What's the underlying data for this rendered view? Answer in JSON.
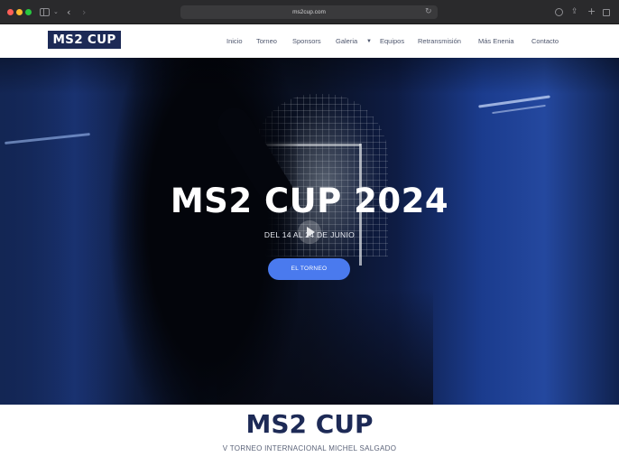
{
  "browser": {
    "url": "ms2cup.com"
  },
  "header": {
    "logo_text": "MS2 CUP",
    "nav": [
      {
        "label": "Inicio"
      },
      {
        "label": "Torneo"
      },
      {
        "label": "Sponsors"
      },
      {
        "label": "Galeria"
      },
      {
        "label": "Equipos"
      },
      {
        "label": "Retransmisión"
      },
      {
        "label": "Más Enenia"
      },
      {
        "label": "Contacto"
      }
    ]
  },
  "hero": {
    "title": "MS2 CUP 2024",
    "date": "DEL 14 AL 24 DE JUNIO",
    "button_label": "EL TORNEO"
  },
  "intro": {
    "title": "MS2 CUP",
    "subtitle": "V TORNEO INTERNACIONAL MICHEL SALGADO"
  },
  "colors": {
    "brand_navy": "#1d2a56",
    "button_blue": "#4a7aee",
    "nav_text": "#4e566d"
  }
}
